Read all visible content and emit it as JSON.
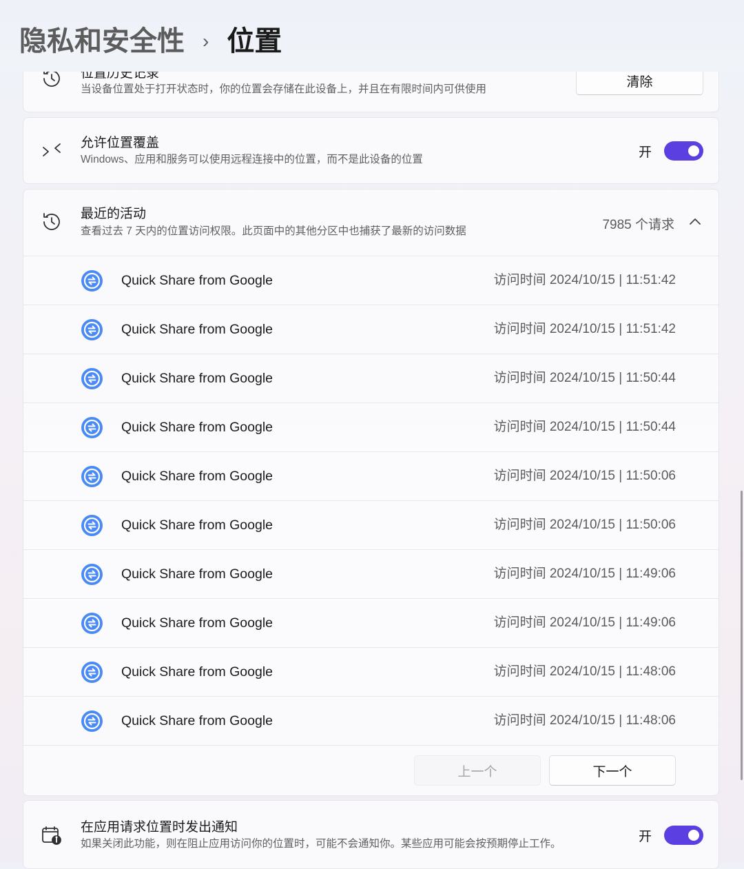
{
  "breadcrumb": {
    "parent": "隐私和安全性",
    "separator": "›",
    "current": "位置"
  },
  "location_history": {
    "title": "位置历史记录",
    "description": "当设备位置处于打开状态时，你的位置会存储在此设备上，并且在有限时间内可供使用",
    "clear_button": "清除",
    "icon": "history-icon"
  },
  "override": {
    "title": "允许位置覆盖",
    "description": "Windows、应用和服务可以使用远程连接中的位置，而不是此设备的位置",
    "toggle_label": "开",
    "toggle_on": true,
    "icon": "remote-override-icon"
  },
  "recent_activity": {
    "title": "最近的活动",
    "description": "查看过去 7 天内的位置访问权限。此页面中的其他分区中也捕获了最新的访问数据",
    "request_count": "7985 个请求",
    "icon": "history-icon",
    "items": [
      {
        "app": "Quick Share from Google",
        "time": "访问时间 2024/10/15 | 11:51:42"
      },
      {
        "app": "Quick Share from Google",
        "time": "访问时间 2024/10/15 | 11:51:42"
      },
      {
        "app": "Quick Share from Google",
        "time": "访问时间 2024/10/15 | 11:50:44"
      },
      {
        "app": "Quick Share from Google",
        "time": "访问时间 2024/10/15 | 11:50:44"
      },
      {
        "app": "Quick Share from Google",
        "time": "访问时间 2024/10/15 | 11:50:06"
      },
      {
        "app": "Quick Share from Google",
        "time": "访问时间 2024/10/15 | 11:50:06"
      },
      {
        "app": "Quick Share from Google",
        "time": "访问时间 2024/10/15 | 11:49:06"
      },
      {
        "app": "Quick Share from Google",
        "time": "访问时间 2024/10/15 | 11:49:06"
      },
      {
        "app": "Quick Share from Google",
        "time": "访问时间 2024/10/15 | 11:48:06"
      },
      {
        "app": "Quick Share from Google",
        "time": "访问时间 2024/10/15 | 11:48:06"
      }
    ],
    "prev_button": "上一个",
    "next_button": "下一个"
  },
  "notify": {
    "title": "在应用请求位置时发出通知",
    "description": "如果关闭此功能，则在阻止应用访问你的位置时，可能不会通知你。某些应用可能会按预期停止工作。",
    "toggle_label": "开",
    "toggle_on": true,
    "icon": "notification-info-icon"
  },
  "colors": {
    "accent": "#5b3fe0",
    "app_icon_blue": "#4a8af4"
  }
}
